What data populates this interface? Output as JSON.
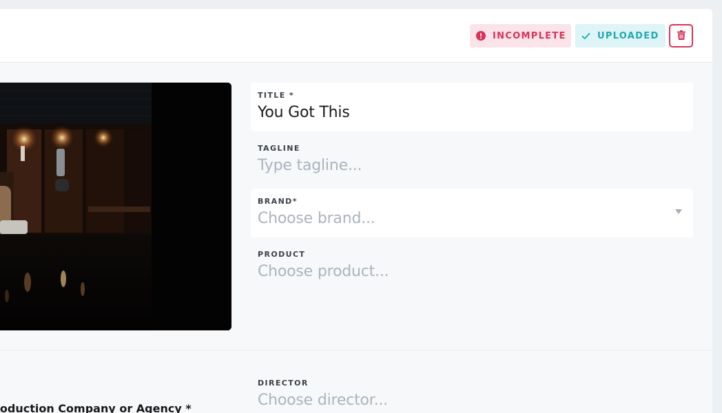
{
  "header": {
    "status_incomplete": "INCOMPLETE",
    "status_uploaded": "UPLOADED"
  },
  "form": {
    "title": {
      "label": "TITLE *",
      "value": "You Got This"
    },
    "tagline": {
      "label": "TAGLINE",
      "placeholder": "Type tagline..."
    },
    "brand": {
      "label": "BRAND*",
      "placeholder": "Choose brand..."
    },
    "product": {
      "label": "PRODUCT",
      "placeholder": "Choose product..."
    },
    "director": {
      "label": "DIRECTOR",
      "placeholder": "Choose director..."
    },
    "production_company": {
      "label": "roduction Company or Agency *"
    }
  },
  "icons": {
    "incomplete": "alert-circle-icon",
    "uploaded": "check-icon",
    "delete": "trash-icon",
    "select": "triangle-down-icon"
  },
  "colors": {
    "danger": "#d8325a",
    "danger_bg": "#fbe4e9",
    "success": "#21a8b4",
    "success_bg": "#def4f6",
    "placeholder": "#a9b4bd"
  }
}
